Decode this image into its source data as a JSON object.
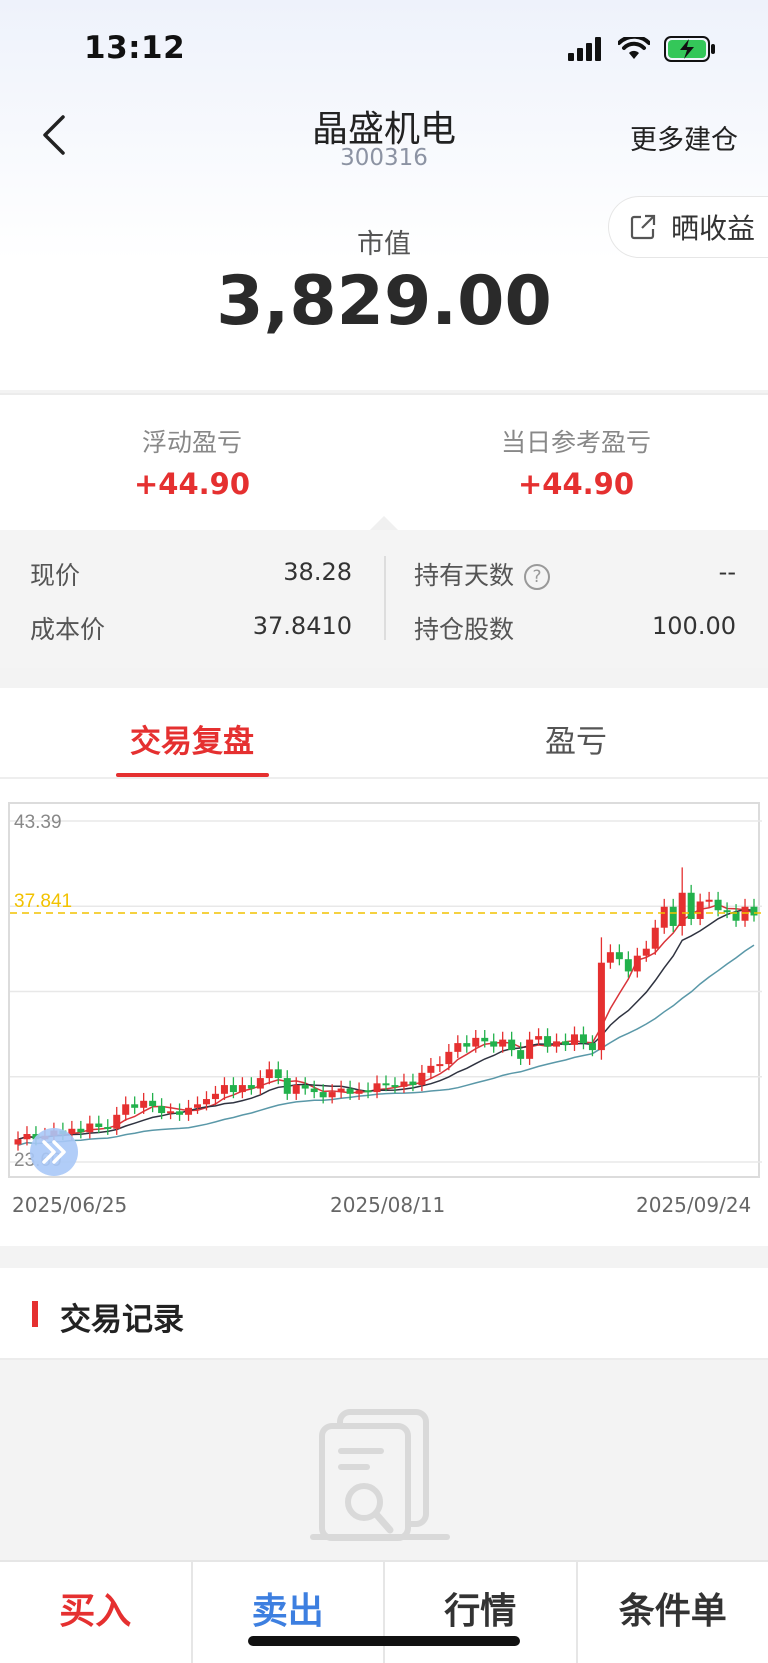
{
  "status_bar": {
    "time": "13:12"
  },
  "header": {
    "title": "晶盛机电",
    "code": "300316",
    "more_label": "更多建仓",
    "share_label": "晒收益"
  },
  "market_value": {
    "label": "市值",
    "value": "3,829.00"
  },
  "pnl": {
    "floating_label": "浮动盈亏",
    "floating_value": "+44.90",
    "daily_label": "当日参考盈亏",
    "daily_value": "+44.90"
  },
  "details": {
    "price_label": "现价",
    "price_value": "38.28",
    "cost_label": "成本价",
    "cost_value": "37.8410",
    "days_label": "持有天数",
    "days_value": "--",
    "shares_label": "持仓股数",
    "shares_value": "100.00"
  },
  "tabs": {
    "active": "交易复盘",
    "inactive": "盈亏"
  },
  "chart_data": {
    "type": "candlestick",
    "ylim": [
      23.6,
      43.39
    ],
    "y_top_label": "43.39",
    "y_bottom_label": "23.60",
    "cost_line": 37.841,
    "cost_line_label": "37.841",
    "x_labels": [
      "2025/06/25",
      "2025/08/11",
      "2025/09/24"
    ],
    "closes": [
      24.9,
      25.2,
      24.9,
      25.1,
      25.4,
      25.2,
      25.5,
      25.3,
      25.8,
      25.6,
      25.5,
      26.3,
      26.9,
      26.7,
      27.1,
      26.8,
      26.4,
      26.5,
      26.3,
      26.7,
      26.9,
      27.2,
      27.5,
      28.0,
      27.6,
      28.0,
      27.8,
      28.4,
      28.9,
      28.4,
      27.5,
      28.0,
      27.8,
      27.6,
      27.3,
      27.6,
      27.8,
      27.5,
      27.7,
      27.6,
      28.1,
      28.0,
      27.9,
      28.2,
      28.0,
      28.7,
      29.1,
      29.2,
      29.9,
      30.4,
      30.2,
      30.7,
      30.5,
      30.2,
      30.6,
      30.0,
      29.5,
      30.6,
      30.8,
      30.2,
      30.5,
      30.3,
      30.9,
      30.4,
      30.0,
      35.0,
      35.6,
      35.2,
      34.5,
      35.4,
      35.8,
      37.0,
      38.2,
      37.1,
      39.0,
      37.5,
      38.5,
      38.6,
      38.0,
      37.9,
      37.4,
      38.2,
      37.7
    ]
  },
  "records": {
    "title": "交易记录"
  },
  "bottom_bar": {
    "buy": "买入",
    "sell": "卖出",
    "quote": "行情",
    "conditional": "条件单"
  },
  "colors": {
    "up": "#e53030",
    "down": "#22b14c",
    "accent": "#e53030",
    "sell": "#3d7fe0",
    "cost_line": "#f2c200"
  }
}
